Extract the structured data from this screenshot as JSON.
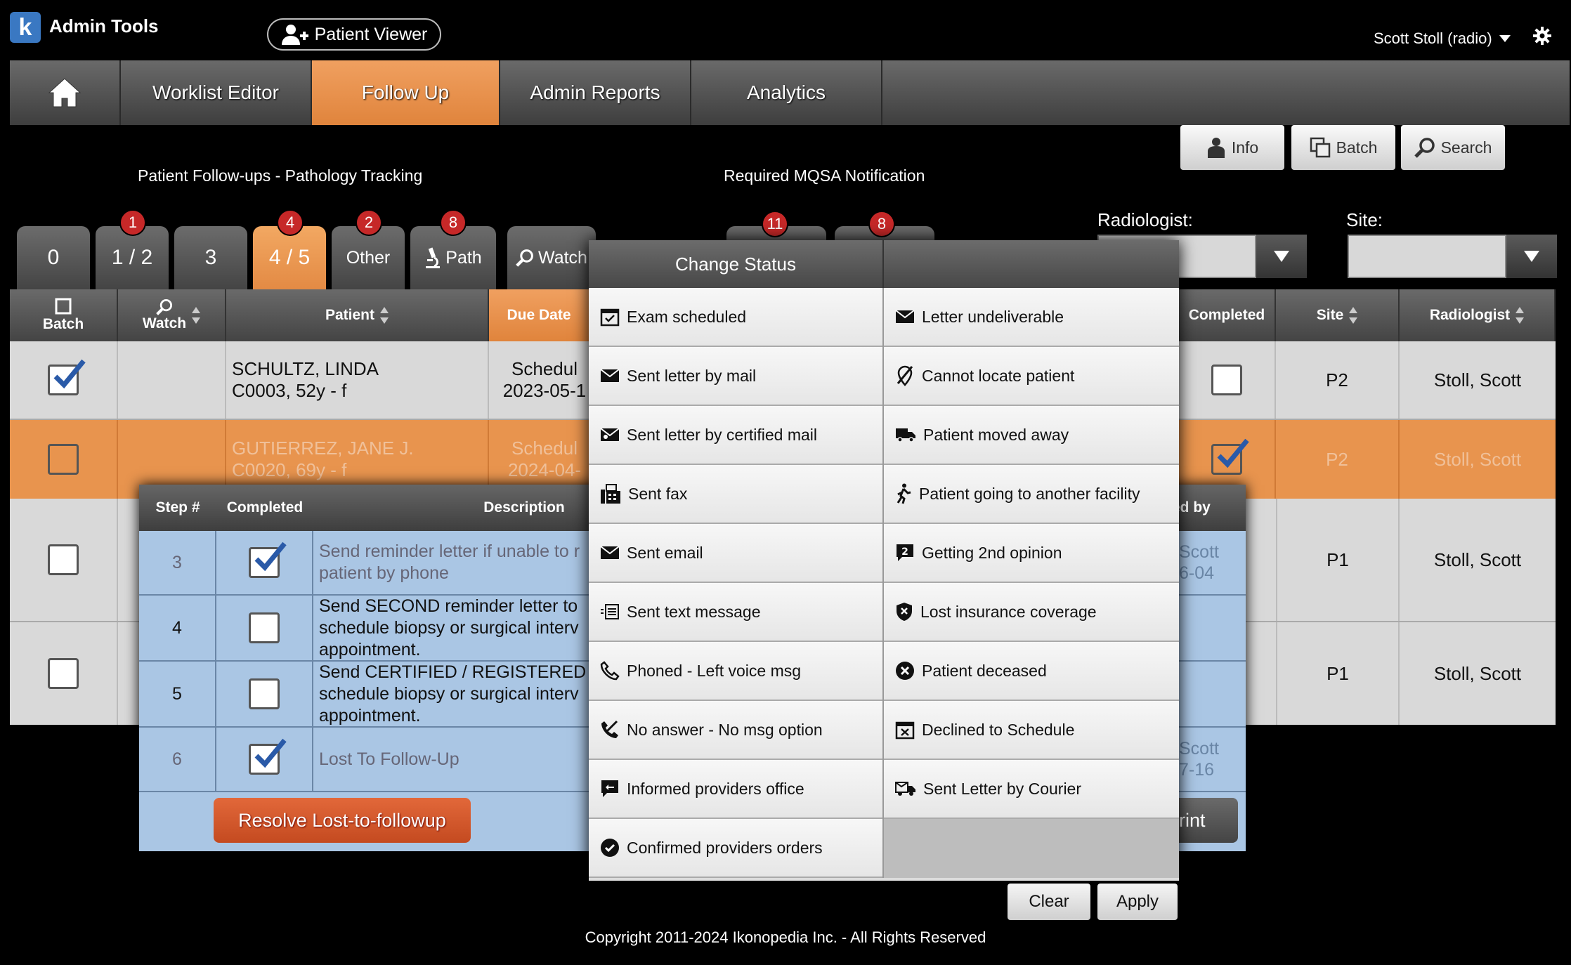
{
  "header": {
    "logo_letter": "k",
    "app_title": "Admin Tools",
    "patient_viewer_label": "Patient Viewer",
    "user_name": "Scott Stoll (radio)"
  },
  "nav": {
    "tabs": [
      {
        "label": ""
      },
      {
        "label": "Worklist Editor"
      },
      {
        "label": "Follow Up"
      },
      {
        "label": "Admin Reports"
      },
      {
        "label": "Analytics"
      }
    ]
  },
  "toolbar": {
    "info_label": "Info",
    "batch_label": "Batch",
    "search_label": "Search"
  },
  "sections": {
    "left_title": "Patient Follow-ups - Pathology Tracking",
    "right_title": "Required MQSA Notification"
  },
  "filter_tabs": [
    {
      "label": "0",
      "badge": ""
    },
    {
      "label": "1 / 2",
      "badge": "1"
    },
    {
      "label": "3",
      "badge": ""
    },
    {
      "label": "4 / 5",
      "badge": "4"
    },
    {
      "label": "Other",
      "badge": "2"
    },
    {
      "label": "Path",
      "badge": "8"
    },
    {
      "label": "Watch",
      "badge": ""
    }
  ],
  "mqsa_badges": [
    "11",
    "8"
  ],
  "filters": {
    "radiologist_label": "Radiologist:",
    "site_label": "Site:"
  },
  "table": {
    "headers": {
      "batch": "Batch",
      "watch": "Watch",
      "patient": "Patient",
      "due_date": "Due Date",
      "completed": "Completed",
      "site": "Site",
      "radiologist": "Radiologist"
    },
    "rows": [
      {
        "patient_name": "SCHULTZ, LINDA",
        "patient_info": "C0003, 52y - f",
        "due_line1": "Schedul",
        "due_line2": "2023-05-1",
        "site": "P2",
        "radiologist": "Stoll, Scott"
      },
      {
        "patient_name": "GUTIERREZ, JANE J.",
        "patient_info": "C0020, 69y - f",
        "due_line1": "Schedul",
        "due_line2": "2024-04-",
        "site": "P2",
        "radiologist": "Stoll, Scott"
      },
      {
        "site": "P1",
        "radiologist": "Stoll, Scott"
      },
      {
        "site": "P1",
        "radiologist": "Stoll, Scott"
      }
    ]
  },
  "steps": {
    "headers": {
      "step": "Step #",
      "completed": "Completed",
      "description": "Description",
      "completed_by": "ed by"
    },
    "rows": [
      {
        "step": "3",
        "line1": "Send reminder letter if unable to r",
        "line2": "patient by phone",
        "line3": "",
        "by1": "Scott",
        "by2": "6-04"
      },
      {
        "step": "4",
        "line1": "Send SECOND reminder letter to",
        "line2": "schedule biopsy or surgical interv",
        "line3": "appointment.",
        "by1": "",
        "by2": ""
      },
      {
        "step": "5",
        "line1": "Send CERTIFIED / REGISTERED",
        "line2": "schedule biopsy or surgical interv",
        "line3": "appointment.",
        "by1": "",
        "by2": ""
      },
      {
        "step": "6",
        "line1": "Lost To Follow-Up",
        "line2": "",
        "line3": "",
        "by1": "Scott",
        "by2": "7-16"
      }
    ],
    "resolve_label": "Resolve Lost-to-followup",
    "print_label": "rint"
  },
  "change_status": {
    "title": "Change Status",
    "left": [
      "Exam scheduled",
      "Sent letter by mail",
      "Sent letter by certified mail",
      "Sent fax",
      "Sent email",
      "Sent text message",
      "Phoned - Left voice msg",
      "No answer - No msg option",
      "Informed providers office",
      "Confirmed providers orders"
    ],
    "right": [
      "Letter undeliverable",
      "Cannot locate patient",
      "Patient moved away",
      "Patient going to another facility",
      "Getting 2nd opinion",
      "Lost insurance coverage",
      "Patient deceased",
      "Declined to Schedule",
      "Sent Letter by Courier"
    ]
  },
  "actions": {
    "clear_label": "Clear",
    "apply_label": "Apply"
  },
  "footer": {
    "copyright": "Copyright 2011-2024 Ikonopedia Inc. - All Rights Reserved"
  },
  "colors": {
    "accent": "#e8944e",
    "row_highlight": "#e8944e",
    "panel_blue": "#aac6e4",
    "resolve_red": "#d2512a",
    "badge_red": "#c62828",
    "check_blue": "#2a5aa8"
  }
}
